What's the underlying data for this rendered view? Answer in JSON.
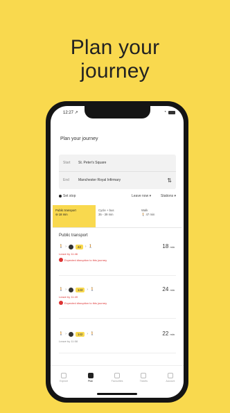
{
  "headline": [
    "Plan your",
    "journey"
  ],
  "status": {
    "time": "12:27 ↗"
  },
  "screen": {
    "title": "Plan your journey",
    "from": {
      "label": "Start",
      "value": "St. Peter's Square"
    },
    "to": {
      "label": "End",
      "value": "Manchester Royal Infirmary"
    },
    "options": {
      "set_stop": "Set stop",
      "leave": "Leave now ▾",
      "stations": "Stations ▾"
    },
    "modes": [
      {
        "label": "Public transport",
        "sub": "⊖ 18 min",
        "active": true
      },
      {
        "label": "Cycle + bus",
        "sub": "35 - 39 min",
        "active": false
      },
      {
        "label": "Walk",
        "sub": "🚶 47 min",
        "active": false
      }
    ],
    "section_title": "Public transport",
    "routes": [
      {
        "badge": "42",
        "duration": "18",
        "unit": "min",
        "leave_by": "Leave by 11:46",
        "alert": "Expected disruption to this journey"
      },
      {
        "badge": "143",
        "duration": "24",
        "unit": "min",
        "leave_by": "Leave by 11:49",
        "alert": "Expected disruption to this journey"
      },
      {
        "badge": "142",
        "duration": "22",
        "unit": "min",
        "leave_by": "Leave by 11:58",
        "alert": ""
      }
    ],
    "tabs": [
      "Explore",
      "Plan",
      "Favourites",
      "Tickets",
      "Account"
    ]
  },
  "colors": {
    "accent": "#F9D94E",
    "alert": "#DD3333"
  }
}
